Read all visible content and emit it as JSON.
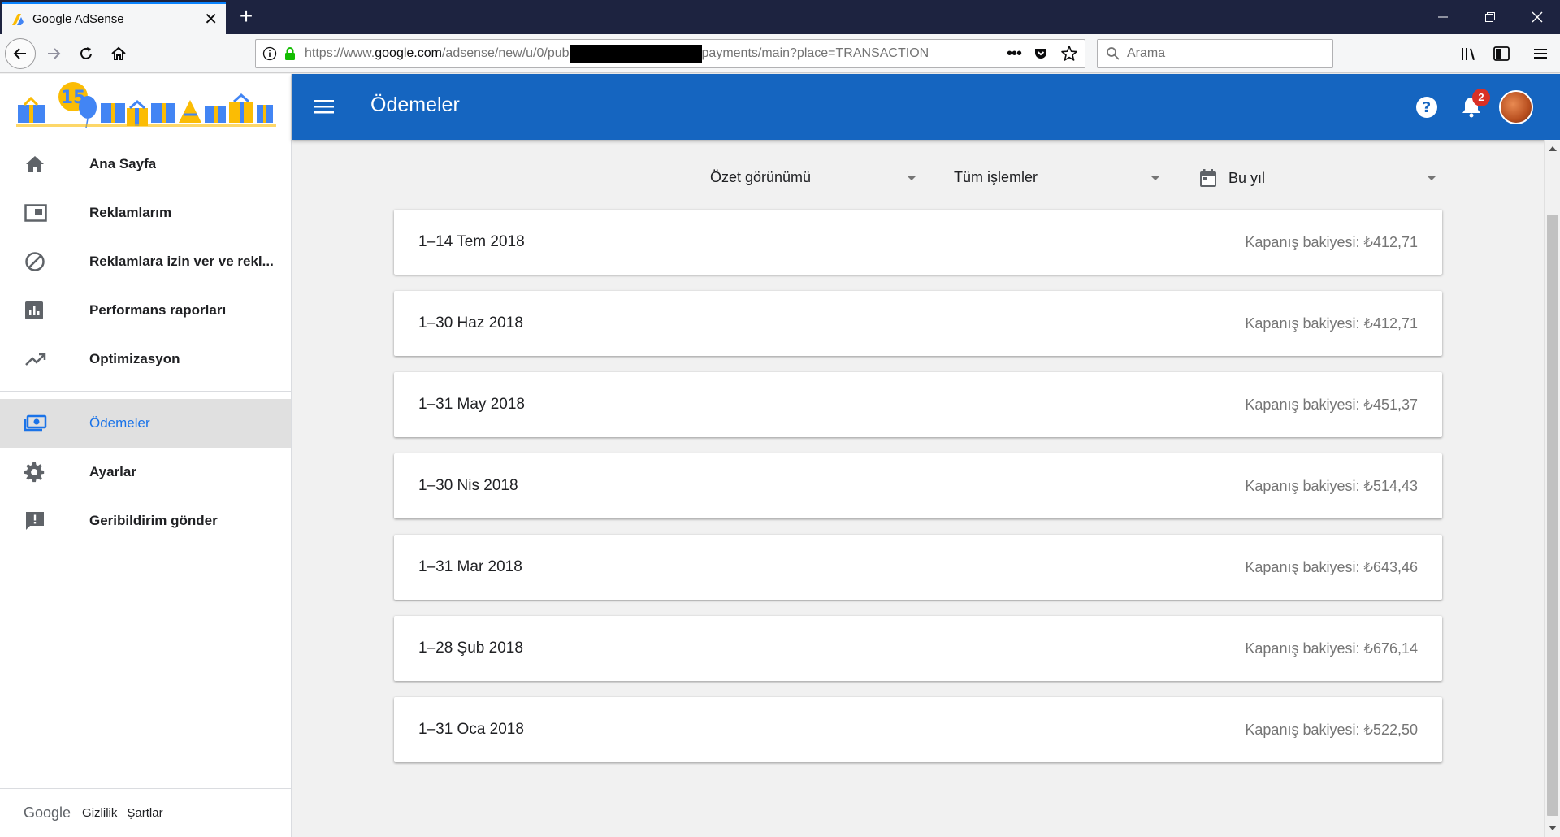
{
  "browser": {
    "tab_title": "Google AdSense",
    "url_prefix": "https://www.",
    "url_host": "google.com",
    "url_path": "/adsense/new/u/0/pub",
    "url_suffix": "payments/main?place=TRANSACTION",
    "search_placeholder": "Arama"
  },
  "sidebar": {
    "items": [
      {
        "label": "Ana Sayfa",
        "icon": "home-icon"
      },
      {
        "label": "Reklamlarım",
        "icon": "ad-unit-icon"
      },
      {
        "label": "Reklamlara izin ver ve rekl...",
        "icon": "block-icon"
      },
      {
        "label": "Performans raporları",
        "icon": "bar-chart-icon"
      },
      {
        "label": "Optimizasyon",
        "icon": "trending-up-icon"
      },
      {
        "label": "Ödemeler",
        "icon": "payments-icon",
        "active": true
      },
      {
        "label": "Ayarlar",
        "icon": "gear-icon"
      },
      {
        "label": "Geribildirim gönder",
        "icon": "feedback-icon"
      }
    ],
    "footer": {
      "brand": "Google",
      "privacy": "Gizlilik",
      "terms": "Şartlar"
    }
  },
  "header": {
    "title": "Ödemeler",
    "notification_count": "2"
  },
  "filters": {
    "view": "Özet görünümü",
    "transactions": "Tüm işlemler",
    "period": "Bu yıl"
  },
  "statements": [
    {
      "period": "1–14 Tem 2018",
      "balance": "Kapanış bakiyesi: ₺412,71"
    },
    {
      "period": "1–30 Haz 2018",
      "balance": "Kapanış bakiyesi: ₺412,71"
    },
    {
      "period": "1–31 May 2018",
      "balance": "Kapanış bakiyesi: ₺451,37"
    },
    {
      "period": "1–30 Nis 2018",
      "balance": "Kapanış bakiyesi: ₺514,43"
    },
    {
      "period": "1–31 Mar 2018",
      "balance": "Kapanış bakiyesi: ₺643,46"
    },
    {
      "period": "1–28 Şub 2018",
      "balance": "Kapanış bakiyesi: ₺676,14"
    },
    {
      "period": "1–31 Oca 2018",
      "balance": "Kapanış bakiyesi: ₺522,50"
    }
  ],
  "colors": {
    "appbar": "#1565c0",
    "active_nav_text": "#1a73e8",
    "browser_titlebar": "#1d2340",
    "badge": "#d93025"
  }
}
